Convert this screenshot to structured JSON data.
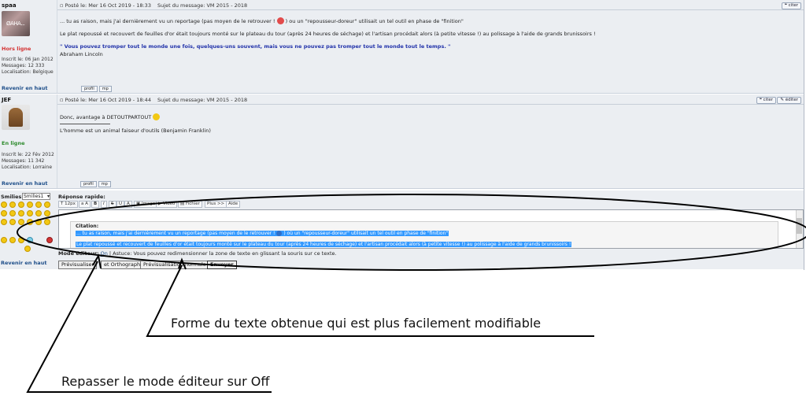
{
  "posts": [
    {
      "author": "spaa",
      "avatar_text": "ØAHA...",
      "status": "Hors ligne",
      "joined": "Inscrit le: 06 Jan 2012",
      "messages": "Messages: 12 333",
      "location": "Localisation: Belgique",
      "header": "Posté le: Mer 16 Oct 2019 - 18:33",
      "subject": "Sujet du message: VM 2015 - 2018",
      "quote_btn": "citer",
      "para1_a": "... tu as raison, mais j'ai dernièrement vu un reportage (pas moyen de le retrouver !",
      "para1_b": ") ou un \"repousseur-doreur\" utilisait un tel outil en phase de \"finition\"",
      "para2": "Le plat repoussé et recouvert de feuilles d'or était toujours monté sur le plateau du tour (après 24 heures de séchage) et l'artisan procédait alors (à petite vitesse !) au polissage à l'aide de grands brunissoirs !",
      "signature_quote": "\" Vous pouvez tromper tout le monde une fois, quelques-uns souvent, mais vous ne pouvez pas tromper tout le monde tout le temps. \"",
      "signature_author": "Abraham Lincoln",
      "back_top": "Revenir en haut",
      "profile_btn": "profil",
      "mp_btn": "mp"
    },
    {
      "author": "JEF",
      "status": "En ligne",
      "joined": "Inscrit le: 22 Fév 2012",
      "messages": "Messages: 11 342",
      "location": "Localisation: Lorraine",
      "header": "Posté le: Mer 16 Oct 2019 - 18:44",
      "subject": "Sujet du message: VM 2015 - 2018",
      "quote_btn": "citer",
      "edit_btn": "éditer",
      "text": "Donc, avantage à DETOUTPARTOUT",
      "signature": "L'homme est un animal faiseur d'outils (Benjamin Franklin)",
      "back_top": "Revenir en haut",
      "profile_btn": "profil",
      "mp_btn": "mp"
    }
  ],
  "quick_reply": {
    "smilies_label": "Smilies:",
    "smilies_select": "Smilies1",
    "reply_label": "Réponse rapide:",
    "toolbar": [
      "12px",
      "B",
      "I",
      "S",
      "Image",
      "Vidéo",
      "Fichier",
      "Plus >>",
      "Aide"
    ],
    "citation_label": "Citation:",
    "cite_line1": "... tu as raison, mais j'ai dernièrement vu un reportage (pas moyen de le retrouver !",
    "cite_line1_b": ") où un \"repousseur-doreur\" utilisait un tel outil en phase de \"finition\"",
    "cite_line2": "Le plat repoussé et recouvert de feuilles d'or était toujours monté sur le plateau du tour (après 24 heures de séchage) et l'artisan procédait alors (à petite vitesse !) au polissage à l'aide de grands brunissoirs !",
    "editor_mode_label": "Mode éditeur:",
    "editor_mode_value": "On",
    "editor_tip": "| Astuce: Vous pouvez redimensionner la zone de texte en glissant la souris sur ce texte.",
    "btn_preview": "Prévisualiser",
    "btn_spell": "et Orthographe",
    "btn_normal": "Prévisualisation normale",
    "btn_send": "Envoyer",
    "back_top": "Revenir en haut"
  },
  "annotations": {
    "a1": "Forme du texte obtenue qui est plus facilement modifiable",
    "a2": "Repasser le mode éditeur sur Off"
  }
}
